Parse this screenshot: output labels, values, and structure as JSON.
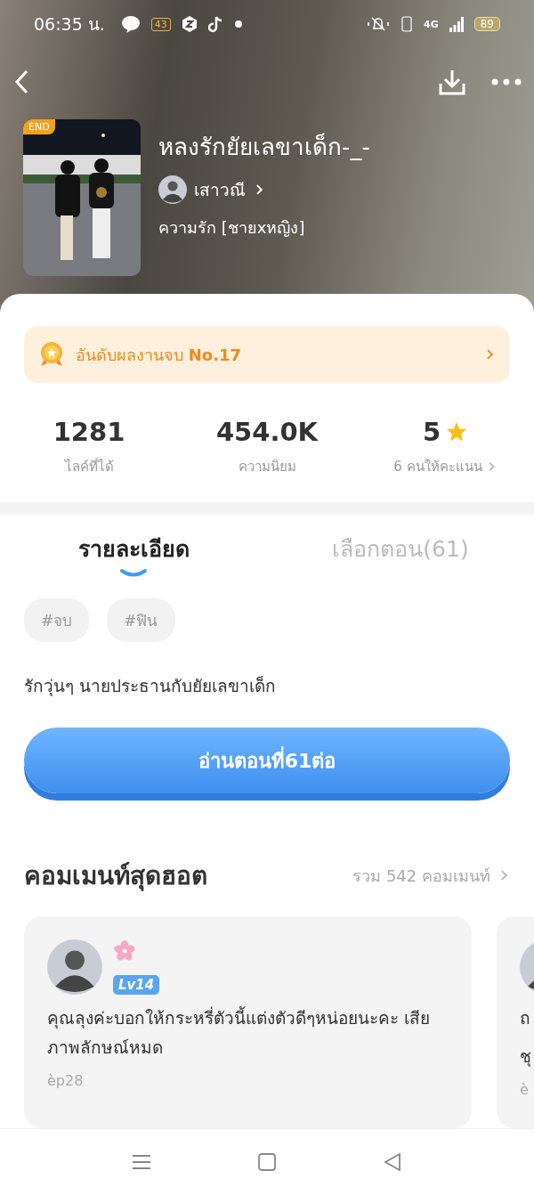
{
  "status_bar": {
    "time": "06:35 น.",
    "notification_badge": "43",
    "network": "4G",
    "battery": "89"
  },
  "book": {
    "cover": {
      "kind": "picture",
      "badge": "END"
    },
    "title": "หลงรักยัยเลขาเด็ก-_-",
    "author": "เสาวณี",
    "genre": "ความรัก [ชายxหญิง]"
  },
  "rank_banner": {
    "label": "อันดับผลงานจบ",
    "rank": "No.17"
  },
  "stats": [
    {
      "kind": "plain",
      "value": "1281",
      "label": "ไลค์ที่ได้"
    },
    {
      "kind": "plain",
      "value": "454.0K",
      "label": "ความนิยม"
    },
    {
      "kind": "rating",
      "value": "5",
      "label": "6 คนให้คะแนน"
    }
  ],
  "tabs": [
    {
      "label": "รายละเอียด",
      "selected": true
    },
    {
      "label": "เลือกตอน(61)",
      "selected": false
    }
  ],
  "tags": [
    "#จบ",
    "#ฟิน"
  ],
  "description": "รักวุ่นๆ นายประธานกับยัยเลขาเด็ก",
  "read_button": "อ่านตอนที่61ต่อ",
  "comments": {
    "title": "คอมเมนท์สุดฮอต",
    "total": "รวม 542 คอมเมนท์",
    "items": [
      {
        "level": "Lv14",
        "text": "คุณลุงค่ะบอกให้กระหรี่ตัวนี้แต่งตัวดีๆหน่อยนะคะ เสียภาพลักษณ์หมด",
        "episode": "èp28"
      },
      {
        "text_lines": [
          "ถ",
          "ชุ"
        ],
        "episode": "è"
      }
    ]
  }
}
